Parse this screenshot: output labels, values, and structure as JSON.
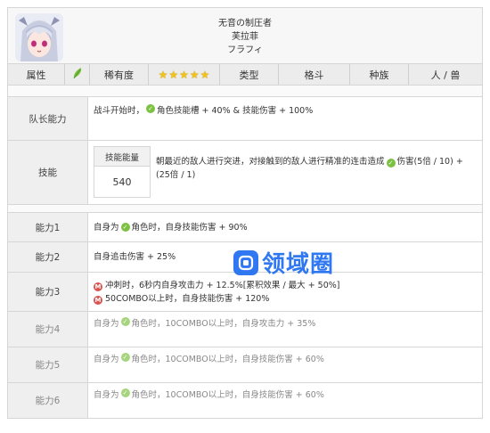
{
  "header": {
    "title_jp": "无音の制圧者",
    "name_cn": "芙拉菲",
    "name_jp": "フラフィ"
  },
  "attrs": {
    "attr_label": "属性",
    "attr_icon": "leaf-icon",
    "rarity_label": "稀有度",
    "rarity_stars": 5,
    "type_label": "类型",
    "type_value": "格斗",
    "race_label": "种族",
    "race_value": "人 / 兽"
  },
  "leader": {
    "label": "队长能力",
    "text_a": "战斗开始时，",
    "text_b": "角色技能槽 + 40% & 技能伤害 + 100%"
  },
  "skill": {
    "label": "技能",
    "energy_label": "技能能量",
    "energy_value": "540",
    "desc_a": "朝最近的敌人进行突进，对接触到的敌人进行精准的连击造成",
    "desc_b": "伤害(5倍 / 10) + (25倍 / 1)"
  },
  "abilities": [
    {
      "label": "能力1",
      "a": "自身为",
      "b": "角色时，自身技能伤害 + 90%"
    },
    {
      "label": "能力2",
      "a": "自身追击伤害 + 25%"
    },
    {
      "label": "能力3",
      "l1": "冲刺时，6秒内自身攻击力 + 12.5%[累积效果 / 最大 + 50%]",
      "l2": "50COMBO以上时，自身技能伤害 + 120%",
      "m": "M"
    },
    {
      "label": "能力4",
      "a": "自身为",
      "b": "角色时，10COMBO以上时，自身攻击力 + 35%"
    },
    {
      "label": "能力5",
      "a": "自身为",
      "b": "角色时，10COMBO以上时，自身技能伤害 + 60%"
    },
    {
      "label": "能力6",
      "a": "自身为",
      "b": "角色时，10COMBO以上时，自身技能伤害 + 60%"
    }
  ],
  "watermark": "领域圈",
  "colors": {
    "accent_green": "#7cc142",
    "watermark_blue": "#1f6df0",
    "m_red": "#d9534f"
  }
}
